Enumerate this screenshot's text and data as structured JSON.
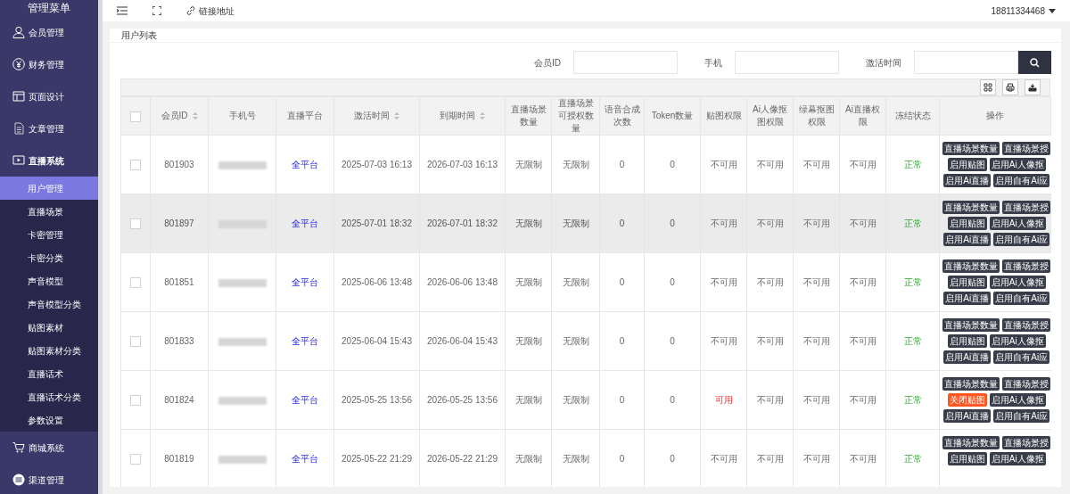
{
  "sidebar": {
    "title": "管理菜单",
    "items": [
      {
        "label": "会员管理",
        "expanded": false
      },
      {
        "label": "财务管理",
        "expanded": false
      },
      {
        "label": "页面设计",
        "expanded": false
      },
      {
        "label": "文章管理",
        "expanded": false
      },
      {
        "label": "直播系统",
        "expanded": true,
        "children": [
          {
            "label": "用户管理",
            "selected": true
          },
          {
            "label": "直播场景",
            "selected": false
          },
          {
            "label": "卡密管理",
            "selected": false
          },
          {
            "label": "卡密分类",
            "selected": false
          },
          {
            "label": "声音模型",
            "selected": false
          },
          {
            "label": "声音模型分类",
            "selected": false
          },
          {
            "label": "贴图素材",
            "selected": false
          },
          {
            "label": "贴图素材分类",
            "selected": false
          },
          {
            "label": "直播话术",
            "selected": false
          },
          {
            "label": "直播话术分类",
            "selected": false
          },
          {
            "label": "参数设置",
            "selected": false
          }
        ]
      },
      {
        "label": "商城系统",
        "expanded": false
      },
      {
        "label": "渠道管理",
        "expanded": false
      }
    ]
  },
  "topbar": {
    "link": "链接地址",
    "user": "18811334468"
  },
  "panel": {
    "title": "用户列表"
  },
  "filters": [
    {
      "label": "会员ID"
    },
    {
      "label": "手机"
    },
    {
      "label": "激活时间"
    }
  ],
  "table": {
    "header_checked": false,
    "columns": [
      {
        "label": "会员ID",
        "sortable": true
      },
      {
        "label": "手机号",
        "sortable": false
      },
      {
        "label": "直播平台",
        "sortable": false
      },
      {
        "label": "激活时间",
        "sortable": true
      },
      {
        "label": "到期时间",
        "sortable": true
      },
      {
        "label": "直播场景数量",
        "sortable": false
      },
      {
        "label": "直播场景可授权数量",
        "sortable": false
      },
      {
        "label": "语音合成次数",
        "sortable": false
      },
      {
        "label": "Token数量",
        "sortable": false
      },
      {
        "label": "贴图权限",
        "sortable": false
      },
      {
        "label": "Ai人像抠图权限",
        "sortable": false
      },
      {
        "label": "绿幕抠图权限",
        "sortable": false
      },
      {
        "label": "Ai直播权限",
        "sortable": false
      },
      {
        "label": "冻结状态",
        "sortable": false
      },
      {
        "label": "操作",
        "sortable": false
      }
    ],
    "rows": [
      {
        "checked": false,
        "highlighted": false,
        "id": "801903",
        "platform": "全平台",
        "activated": "2025-07-03 16:13",
        "expires": "2026-07-03 16:13",
        "scenes": "无限制",
        "scene_auth": "无限制",
        "voice": "0",
        "token": "0",
        "perms": [
          {
            "text": "不可用",
            "available": false
          },
          {
            "text": "不可用",
            "available": false
          },
          {
            "text": "不可用",
            "available": false
          },
          {
            "text": "不可用",
            "available": false
          }
        ],
        "status": "正常",
        "actions": [
          {
            "label": "直播场景数量",
            "danger": false
          },
          {
            "label": "直播场景授",
            "danger": false
          },
          {
            "label": "启用贴图",
            "danger": false
          },
          {
            "label": "启用Ai人像抠",
            "danger": false
          },
          {
            "label": "启用Ai直播",
            "danger": false
          },
          {
            "label": "启用自有Ai应",
            "danger": false
          }
        ]
      },
      {
        "checked": false,
        "highlighted": true,
        "id": "801897",
        "platform": "全平台",
        "activated": "2025-07-01 18:32",
        "expires": "2026-07-01 18:32",
        "scenes": "无限制",
        "scene_auth": "无限制",
        "voice": "0",
        "token": "0",
        "perms": [
          {
            "text": "不可用",
            "available": false
          },
          {
            "text": "不可用",
            "available": false
          },
          {
            "text": "不可用",
            "available": false
          },
          {
            "text": "不可用",
            "available": false
          }
        ],
        "status": "正常",
        "actions": [
          {
            "label": "直播场景数量",
            "danger": false
          },
          {
            "label": "直播场景授",
            "danger": false
          },
          {
            "label": "启用贴图",
            "danger": false
          },
          {
            "label": "启用Ai人像抠",
            "danger": false
          },
          {
            "label": "启用Ai直播",
            "danger": false
          },
          {
            "label": "启用自有Ai应",
            "danger": false
          }
        ]
      },
      {
        "checked": false,
        "highlighted": false,
        "id": "801851",
        "platform": "全平台",
        "activated": "2025-06-06 13:48",
        "expires": "2026-06-06 13:48",
        "scenes": "无限制",
        "scene_auth": "无限制",
        "voice": "0",
        "token": "0",
        "perms": [
          {
            "text": "不可用",
            "available": false
          },
          {
            "text": "不可用",
            "available": false
          },
          {
            "text": "不可用",
            "available": false
          },
          {
            "text": "不可用",
            "available": false
          }
        ],
        "status": "正常",
        "actions": [
          {
            "label": "直播场景数量",
            "danger": false
          },
          {
            "label": "直播场景授",
            "danger": false
          },
          {
            "label": "启用贴图",
            "danger": false
          },
          {
            "label": "启用Ai人像抠",
            "danger": false
          },
          {
            "label": "启用Ai直播",
            "danger": false
          },
          {
            "label": "启用自有Ai应",
            "danger": false
          }
        ]
      },
      {
        "checked": false,
        "highlighted": false,
        "id": "801833",
        "platform": "全平台",
        "activated": "2025-06-04 15:43",
        "expires": "2026-06-04 15:43",
        "scenes": "无限制",
        "scene_auth": "无限制",
        "voice": "0",
        "token": "0",
        "perms": [
          {
            "text": "不可用",
            "available": false
          },
          {
            "text": "不可用",
            "available": false
          },
          {
            "text": "不可用",
            "available": false
          },
          {
            "text": "不可用",
            "available": false
          }
        ],
        "status": "正常",
        "actions": [
          {
            "label": "直播场景数量",
            "danger": false
          },
          {
            "label": "直播场景授",
            "danger": false
          },
          {
            "label": "启用贴图",
            "danger": false
          },
          {
            "label": "启用Ai人像抠",
            "danger": false
          },
          {
            "label": "启用Ai直播",
            "danger": false
          },
          {
            "label": "启用自有Ai应",
            "danger": false
          }
        ]
      },
      {
        "checked": false,
        "highlighted": false,
        "id": "801824",
        "platform": "全平台",
        "activated": "2025-05-25 13:56",
        "expires": "2026-05-25 13:56",
        "scenes": "无限制",
        "scene_auth": "无限制",
        "voice": "0",
        "token": "0",
        "perms": [
          {
            "text": "可用",
            "available": true
          },
          {
            "text": "不可用",
            "available": false
          },
          {
            "text": "不可用",
            "available": false
          },
          {
            "text": "不可用",
            "available": false
          }
        ],
        "status": "正常",
        "actions": [
          {
            "label": "直播场景数量",
            "danger": false
          },
          {
            "label": "直播场景授",
            "danger": false
          },
          {
            "label": "关闭贴图",
            "danger": true
          },
          {
            "label": "启用Ai人像抠",
            "danger": false
          },
          {
            "label": "启用Ai直播",
            "danger": false
          },
          {
            "label": "启用自有Ai应",
            "danger": false
          }
        ]
      },
      {
        "checked": false,
        "highlighted": false,
        "id": "801819",
        "platform": "全平台",
        "activated": "2025-05-22 21:29",
        "expires": "2026-05-22 21:29",
        "scenes": "无限制",
        "scene_auth": "无限制",
        "voice": "0",
        "token": "0",
        "perms": [
          {
            "text": "不可用",
            "available": false
          },
          {
            "text": "不可用",
            "available": false
          },
          {
            "text": "不可用",
            "available": false
          },
          {
            "text": "不可用",
            "available": false
          }
        ],
        "status": "正常",
        "actions": [
          {
            "label": "直播场景数量",
            "danger": false
          },
          {
            "label": "直播场景授",
            "danger": false
          },
          {
            "label": "启用贴图",
            "danger": false
          },
          {
            "label": "启用Ai人像抠",
            "danger": false
          }
        ]
      }
    ]
  }
}
